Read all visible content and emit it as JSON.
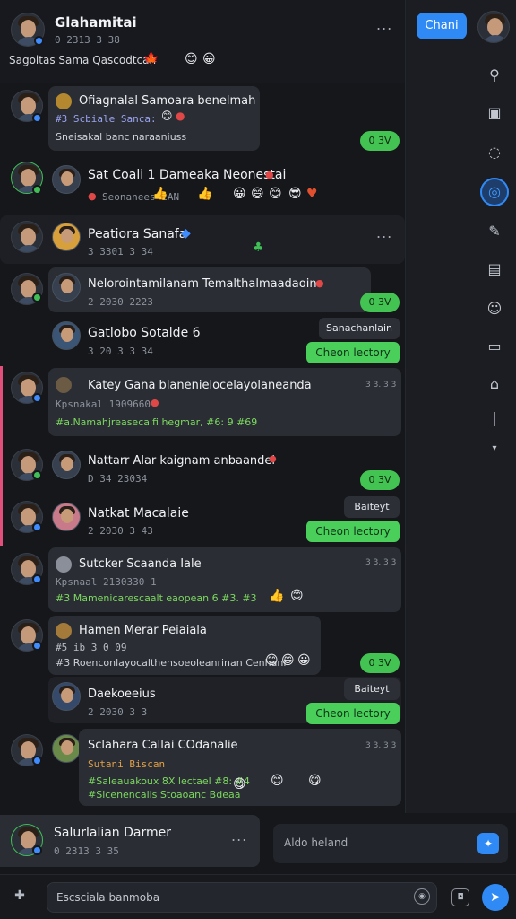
{
  "header": {
    "title": "Glahamitai",
    "subtitle": "0 2313 3 38",
    "status": "Sagoitas Sama Qascodtcan",
    "menu_label": "...",
    "chat_button": "Chani"
  },
  "messages": [
    {
      "name": "Ofiagnalal Samoara benelmah",
      "sub": "#3 Scbiale Sanca:",
      "body": "Sneisakal banc naraaniuss",
      "pill": "0 3V"
    },
    {
      "name": "Sat Coali 1 Dameaka Neonestai",
      "sub": "Seonanees  2AN"
    },
    {
      "name": "Peatiora Sanafa",
      "sub": "3 3301 3 34",
      "menu_label": "..."
    },
    {
      "name": "Nelorointamilanam Temalthalmaadaoin",
      "sub": "2 2030 2223",
      "pill": "0 3V"
    },
    {
      "name": "Gatlobo Sotalde 6",
      "sub": "3 20 3 3 34",
      "chip": "Sanachanlain",
      "action": "Cheon lectory"
    },
    {
      "name": "Katey Gana blanenielocelayolaneanda",
      "sub": "Kpsnakal 1909660",
      "body": "#a.Namahjreasecaifi hegmar, #6: 9 #69",
      "time": "3 3. 3 3"
    },
    {
      "name": "Nattarr Alar kaignam anbaandei",
      "sub": "D 34 23034",
      "pill": "0 3V"
    },
    {
      "name": "Natkat Macalaie",
      "sub": "2 2030 3 43",
      "chip": "Baiteyt",
      "action": "Cheon lectory"
    },
    {
      "name": "Sutcker Scaanda Iale",
      "sub": "Kpsnaal 2130330 1",
      "body": "#3 Mamenicarescaalt eaopean 6 #3. #3",
      "time": "3 3. 3 3"
    },
    {
      "name": "Hamen Merar Peiaiala",
      "sub": "#5 ib 3 0 09",
      "body": "#3 Roenconlayocalthensoeoleanrinan Cenhanl",
      "pill": "0 3V"
    },
    {
      "name": "Daekoeeius",
      "sub": "2 2030 3 3",
      "chip": "Baiteyt",
      "action": "Cheon lectory"
    },
    {
      "name": "Sclahara Callai COdanalie",
      "sub": "Sutani Biscan",
      "body": "#Saleauakoux 8X lectael #8: #4",
      "body2": "#Slcenencalis Stoaoanc Bdeaa",
      "time": "3 3. 3 3"
    }
  ],
  "bottom": {
    "name": "Salurlalian Darmer",
    "sub": "0 2313 3 35",
    "menu_label": "...",
    "status_text": "Aldo heland",
    "composer_placeholder": "Escsciala banmoba"
  },
  "icons": {
    "rail": [
      "person-icon",
      "inbox-icon",
      "help-icon",
      "refresh-icon",
      "pin-icon",
      "note-icon",
      "group-icon",
      "message-icon",
      "bot-icon",
      "divider-icon",
      "chevron-down-icon"
    ],
    "composer": [
      "attachment-icon",
      "emoji-icon",
      "sticker-icon",
      "send-icon"
    ]
  },
  "colors": {
    "accent": "#2f8af5",
    "online": "#3fbf55",
    "action_green": "#4ad05a"
  }
}
